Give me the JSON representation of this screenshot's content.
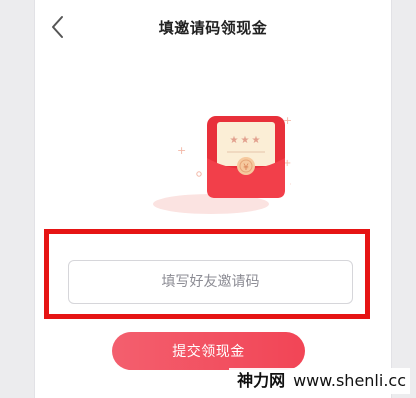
{
  "header": {
    "title": "填邀请码领现金",
    "back_icon": "chevron-left-icon"
  },
  "illustration": {
    "icon": "red-envelope-icon",
    "stars": "★★★",
    "coin_symbol": "¥",
    "colors": {
      "envelope": "#e8303a",
      "card": "#fbeed6",
      "accent": "#f0a48c"
    }
  },
  "invite": {
    "placeholder": "填写好友邀请码",
    "value": "",
    "highlight_color": "#e61414"
  },
  "actions": {
    "submit_label": "提交领现金",
    "submit_color": "#f24b5b"
  },
  "watermark": {
    "site_name": "神力网",
    "url": "www.shenli.cc"
  }
}
